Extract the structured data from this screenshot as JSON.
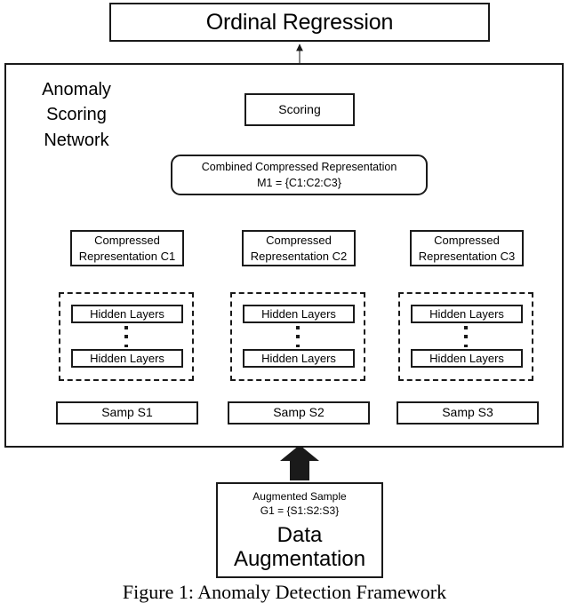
{
  "figure": {
    "caption": "Figure 1:  Anomaly Detection Framework",
    "top_node": {
      "label": "Ordinal Regression"
    },
    "network": {
      "label": "Anomaly\nScoring\nNetwork",
      "scoring": {
        "label": "Scoring"
      },
      "combined_representation": {
        "line1": "Combined Compressed Representation",
        "line2": "M1 = {C1:C2:C3}"
      },
      "branches": [
        {
          "compressed": {
            "line1": "Compressed",
            "line2": "Representation C1"
          },
          "hidden_top": "Hidden Layers",
          "hidden_bottom": "Hidden Layers",
          "sample": "Samp S1"
        },
        {
          "compressed": {
            "line1": "Compressed",
            "line2": "Representation C2"
          },
          "hidden_top": "Hidden Layers",
          "hidden_bottom": "Hidden Layers",
          "sample": "Samp S2"
        },
        {
          "compressed": {
            "line1": "Compressed",
            "line2": "Representation C3"
          },
          "hidden_top": "Hidden Layers",
          "hidden_bottom": "Hidden Layers",
          "sample": "Samp S3"
        }
      ]
    },
    "data_augmentation": {
      "sample_label": "Augmented Sample",
      "sample_formula": "G1 = {S1:S2:S3}",
      "title": "Data\nAugmentation"
    }
  },
  "colors": {
    "stroke": "#1a1a1a",
    "background": "#ffffff",
    "thin_stroke": "#555555"
  }
}
